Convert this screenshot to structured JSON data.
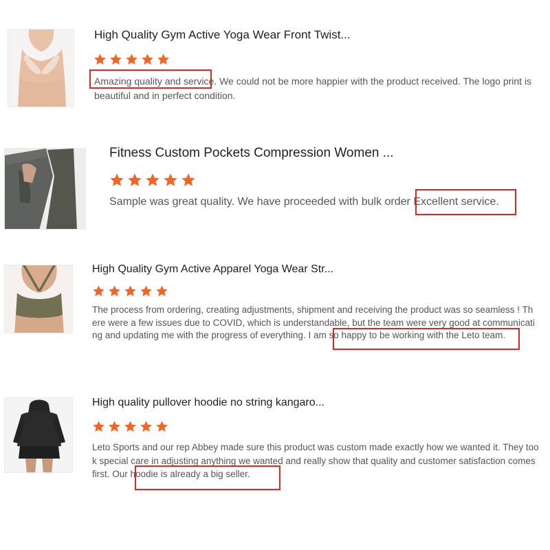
{
  "accent": {
    "star_color": "#f26522",
    "highlight_box_color": "#e0261d"
  },
  "reviews": [
    {
      "title": "High Quality Gym Active Yoga Wear Front Twist...",
      "rating": 5,
      "text_highlight": "Amazing quality and service.",
      "text_rest": " We could not be more happier with the product received.  The logo print is beautiful and in perfect condition.",
      "image_icon": "sports-bra-icon"
    },
    {
      "title": "Fitness Custom Pockets Compression Women ...",
      "rating": 5,
      "text_before": "Sample was great quality. We have proceeded with bulk order",
      "text_highlight": " Excellent service.",
      "image_icon": "leggings-icon"
    },
    {
      "title": "High Quality Gym Active Apparel Yoga Wear Str...",
      "rating": 5,
      "text_before": "The process from ordering, creating adjustments, shipment and receiving the product was so seamless ! There were a few issues due to COVID, which is understandable, but the team were very good at communicating and updating me with the progress of everything. I am ",
      "text_highlight": "so happy to be working with the Leto team.",
      "image_icon": "crossback-bra-icon"
    },
    {
      "title": "High quality pullover hoodie no string kangaro...",
      "rating": 5,
      "text_before": "Leto Sports and our rep Abbey made sure this product was custom made exactly how we wanted it.  They took special care in adjusting anything we wanted and really show that quality and customer satisfaction comes first. ",
      "text_highlight": "Our hoodie is already a big seller.",
      "image_icon": "hoodie-icon"
    }
  ]
}
